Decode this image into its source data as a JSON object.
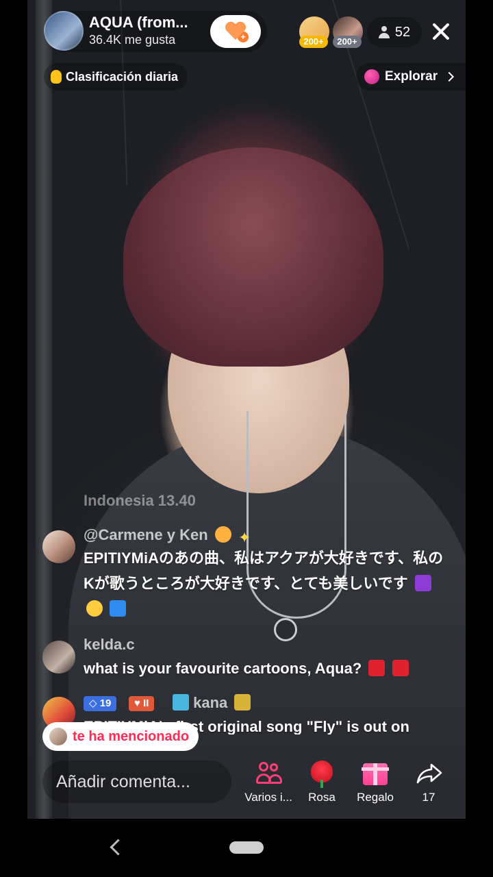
{
  "host": {
    "name": "AQUA (from...",
    "likes": "36.4K me gusta"
  },
  "top_viewers": [
    {
      "badge": "200+",
      "badge_color": "#f5b700"
    },
    {
      "badge": "200+",
      "badge_color": "#6f7380"
    }
  ],
  "viewer_count": "52",
  "ranking_label": "Clasificación diaria",
  "explore_label": "Explorar",
  "chat": {
    "faded_line": "Indonesia 13.40",
    "messages": [
      {
        "user": "@Carmene y Ken",
        "text": "EPITIYMiAのあの曲、私はアクアが大好きです、私のKが歌うところが大好きです、とても美しいです"
      },
      {
        "user": "kelda.c",
        "text": "what is your favourite cartoons, Aqua?"
      },
      {
        "badge_level": "19",
        "badge_fan": "II",
        "user": "kana",
        "text": "EPITIYMiA's first original song \"Fly\" is out on"
      }
    ]
  },
  "mention_text": "te ha mencionado",
  "comment": {
    "placeholder": "Añadir comenta..."
  },
  "actions": [
    {
      "icon": "people-icon",
      "label": "Varios i..."
    },
    {
      "icon": "rose-icon",
      "label": "Rosa"
    },
    {
      "icon": "gift-icon",
      "label": "Regalo"
    },
    {
      "icon": "share-icon",
      "label": "17"
    }
  ],
  "colors": {
    "accent": "#fe2c55",
    "follow_heart": "#ff9a55"
  }
}
